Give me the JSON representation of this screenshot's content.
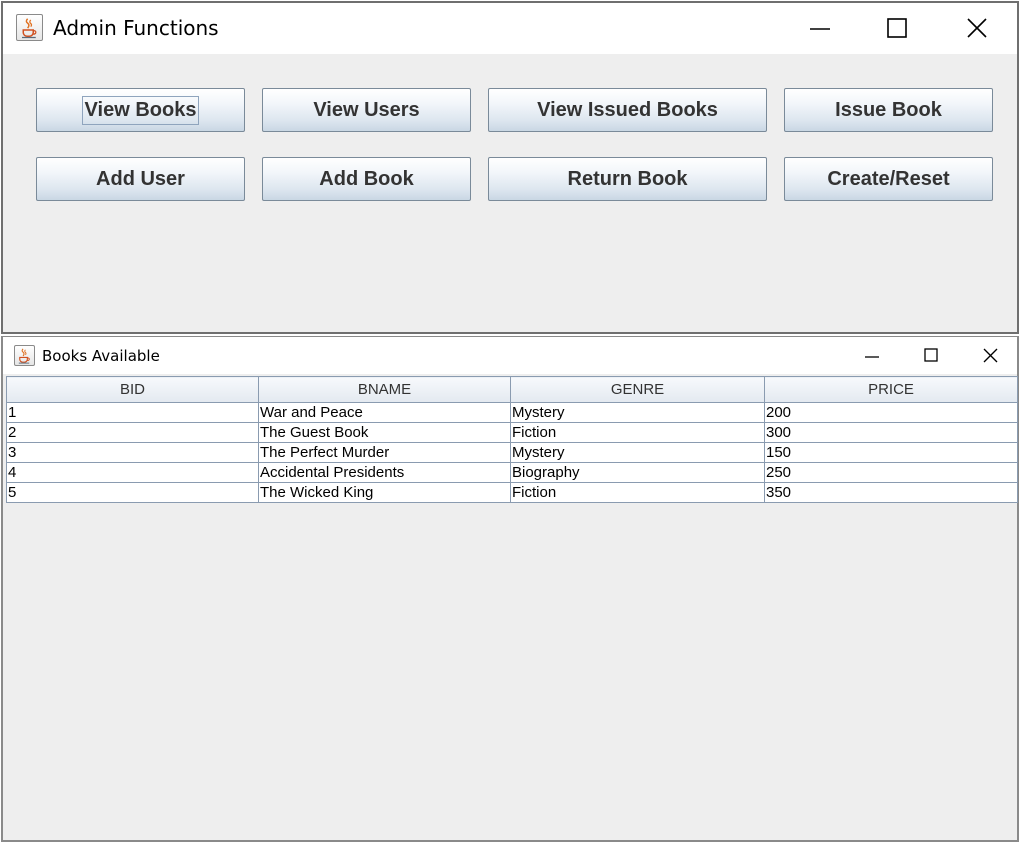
{
  "admin_window": {
    "title": "Admin Functions",
    "buttons": [
      {
        "label": "View Books"
      },
      {
        "label": "View Users"
      },
      {
        "label": "View Issued Books"
      },
      {
        "label": "Issue Book"
      },
      {
        "label": "Add User"
      },
      {
        "label": "Add Book"
      },
      {
        "label": "Return Book"
      },
      {
        "label": "Create/Reset"
      }
    ]
  },
  "books_window": {
    "title": "Books Available",
    "columns": [
      "BID",
      "BNAME",
      "GENRE",
      "PRICE"
    ],
    "rows": [
      [
        "1",
        "War and Peace",
        "Mystery",
        "200"
      ],
      [
        "2",
        "The Guest Book",
        "Fiction",
        "300"
      ],
      [
        "3",
        "The Perfect Murder",
        "Mystery",
        "150"
      ],
      [
        "4",
        "Accidental Presidents",
        "Biography",
        "250"
      ],
      [
        "5",
        "The Wicked King",
        "Fiction",
        "350"
      ]
    ]
  },
  "icons": {
    "app": "java-coffee-cup-icon",
    "minimize": "minimize-icon",
    "maximize": "maximize-icon",
    "close": "close-icon"
  }
}
